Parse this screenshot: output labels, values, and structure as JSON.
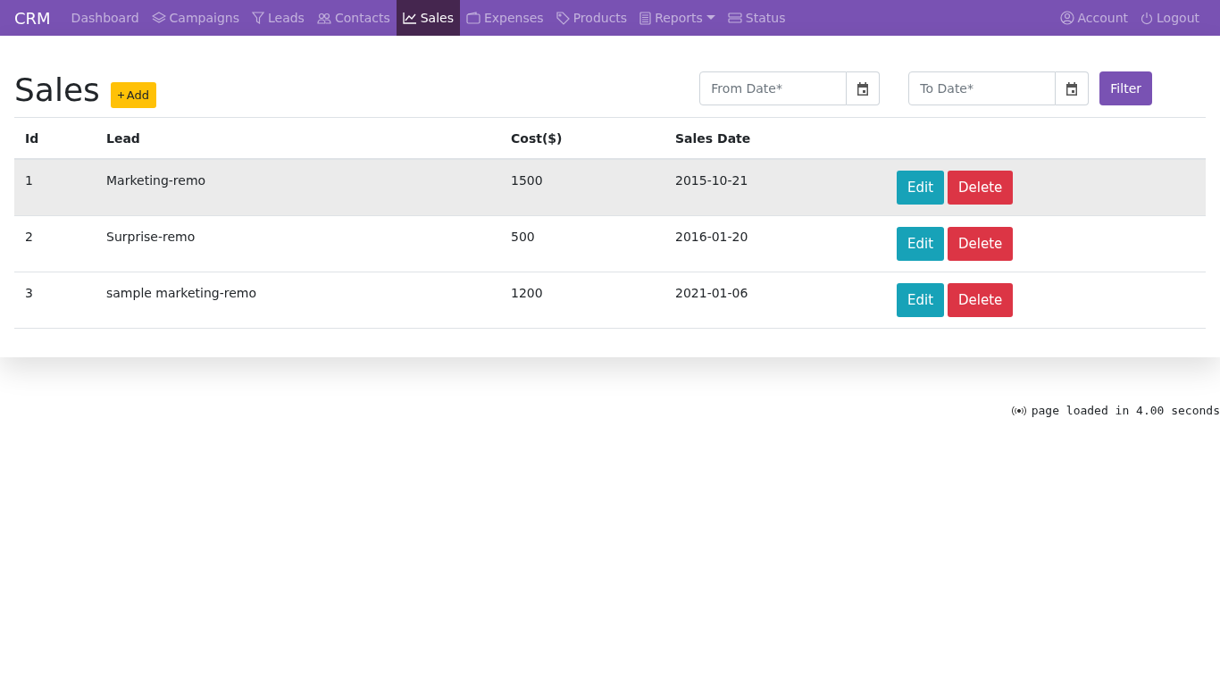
{
  "navbar": {
    "brand": "CRM",
    "items": [
      {
        "label": "Dashboard",
        "selected": false,
        "dropdown": false
      },
      {
        "label": "Campaigns",
        "selected": false,
        "dropdown": false
      },
      {
        "label": "Leads",
        "selected": false,
        "dropdown": false
      },
      {
        "label": "Contacts",
        "selected": false,
        "dropdown": false
      },
      {
        "label": "Sales",
        "selected": true,
        "dropdown": false
      },
      {
        "label": "Expenses",
        "selected": false,
        "dropdown": false
      },
      {
        "label": "Products",
        "selected": false,
        "dropdown": false
      },
      {
        "label": "Reports",
        "selected": false,
        "dropdown": true
      },
      {
        "label": "Status",
        "selected": false,
        "dropdown": false
      }
    ],
    "right_items": [
      {
        "label": "Account"
      },
      {
        "label": "Logout"
      }
    ]
  },
  "page": {
    "title": "Sales",
    "add_button": "Add"
  },
  "filter": {
    "from_date": {
      "placeholder": "From Date*"
    },
    "to_date": {
      "placeholder": "To Date*"
    },
    "button": "Filter"
  },
  "table": {
    "columns": [
      "Id",
      "Lead",
      "Cost($)",
      "Sales Date"
    ],
    "rows": [
      {
        "cells": [
          "1",
          "Marketing-remo",
          "1500",
          "2015-10-21"
        ],
        "selected": true,
        "actions": [
          "Edit",
          "Delete"
        ]
      },
      {
        "cells": [
          "2",
          "Surprise-remo",
          "500",
          "2016-01-20"
        ],
        "selected": false,
        "actions": [
          "Edit",
          "Delete"
        ]
      },
      {
        "cells": [
          "3",
          "sample marketing-remo",
          "1200",
          "2021-01-06"
        ],
        "selected": false,
        "actions": [
          "Edit",
          "Delete"
        ]
      }
    ]
  },
  "footer": {
    "text": "page loaded in 4.00 seconds"
  }
}
